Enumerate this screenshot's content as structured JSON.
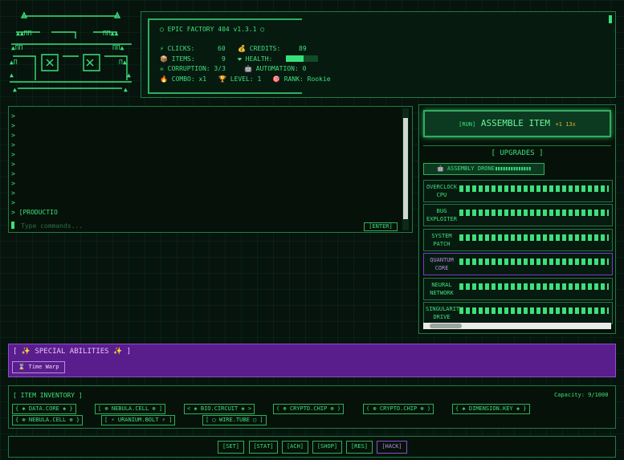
{
  "status": {
    "title": "◯ EPIC FACTORY 404 v1.3.1 ◯",
    "clicks_label": "⚡ CLICKS:",
    "clicks_value": "60",
    "credits_label": "💰 CREDITS:",
    "credits_value": "89",
    "items_label": "📦 ITEMS:",
    "items_value": "9",
    "health_label": "❤ HEALTH:",
    "health_fraction": 0.55,
    "corruption": "☠ CORRUPTION: 3/3",
    "automation": "🤖 AUTOMATION: 0",
    "combo": "🔥 COMBO: x1",
    "level": "🏆 LEVEL: 1",
    "rank": "🎯 RANK: Rookie"
  },
  "terminal": {
    "prompts": [
      ">",
      ">",
      ">",
      ">",
      ">",
      ">",
      ">",
      ">",
      ">",
      ">",
      ">"
    ],
    "last_line": "> [PRODUCTIO",
    "input_placeholder": "Type commands...",
    "enter_label": "[ENTER]"
  },
  "assemble": {
    "run_prefix": "[RUN]",
    "label": "ASSEMBLE ITEM",
    "bonus": "+1 13x"
  },
  "upgrades": {
    "title": "[ UPGRADES ]",
    "drone_label": "🤖 ASSEMBLY DRONE",
    "drone_dots": "▮▮▮▮▮▮▮▮▮▮▮▮▮▮",
    "items": [
      {
        "name": "OVERCLOCK CPU"
      },
      {
        "name": "BUG EXPLOITER"
      },
      {
        "name": "SYSTEM PATCH"
      },
      {
        "name": "QUANTUM CORE"
      },
      {
        "name": "NEURAL NETWORK"
      },
      {
        "name": "SINGULARITY DRIVE"
      }
    ]
  },
  "special": {
    "title": "[ ✨ SPECIAL ABILITIES ✨ ]",
    "time_warp": "⌛ Time Warp"
  },
  "inventory": {
    "title": "[ ITEM INVENTORY ]",
    "capacity": "Capacity: 9/1000",
    "items": [
      "{ ◈ DATA.CORE ◈ }",
      "[ ⊛ NEBULA.CELL ⊛ ]",
      "< ◈ BIO.CIRCUIT ◈ >",
      "( ⊛ CRYPTO.CHIP ⊛ )",
      "( ⊛ CRYPTO.CHIP ⊛ )",
      "{ ◈ DIMENSION.KEY ◈ }",
      "{ ⊛ NEBULA.CELL ⊛ }",
      "[ ⚡ URANIUM.BOLT ⚡ ]",
      "[ ◯ WIRE.TUBE ◯ ]"
    ]
  },
  "nav": {
    "set": "[SET]",
    "stat": "[STAT]",
    "ach": "[ACH]",
    "shop": "[SHOP]",
    "res": "[RES]",
    "hack": "[HACK]"
  }
}
